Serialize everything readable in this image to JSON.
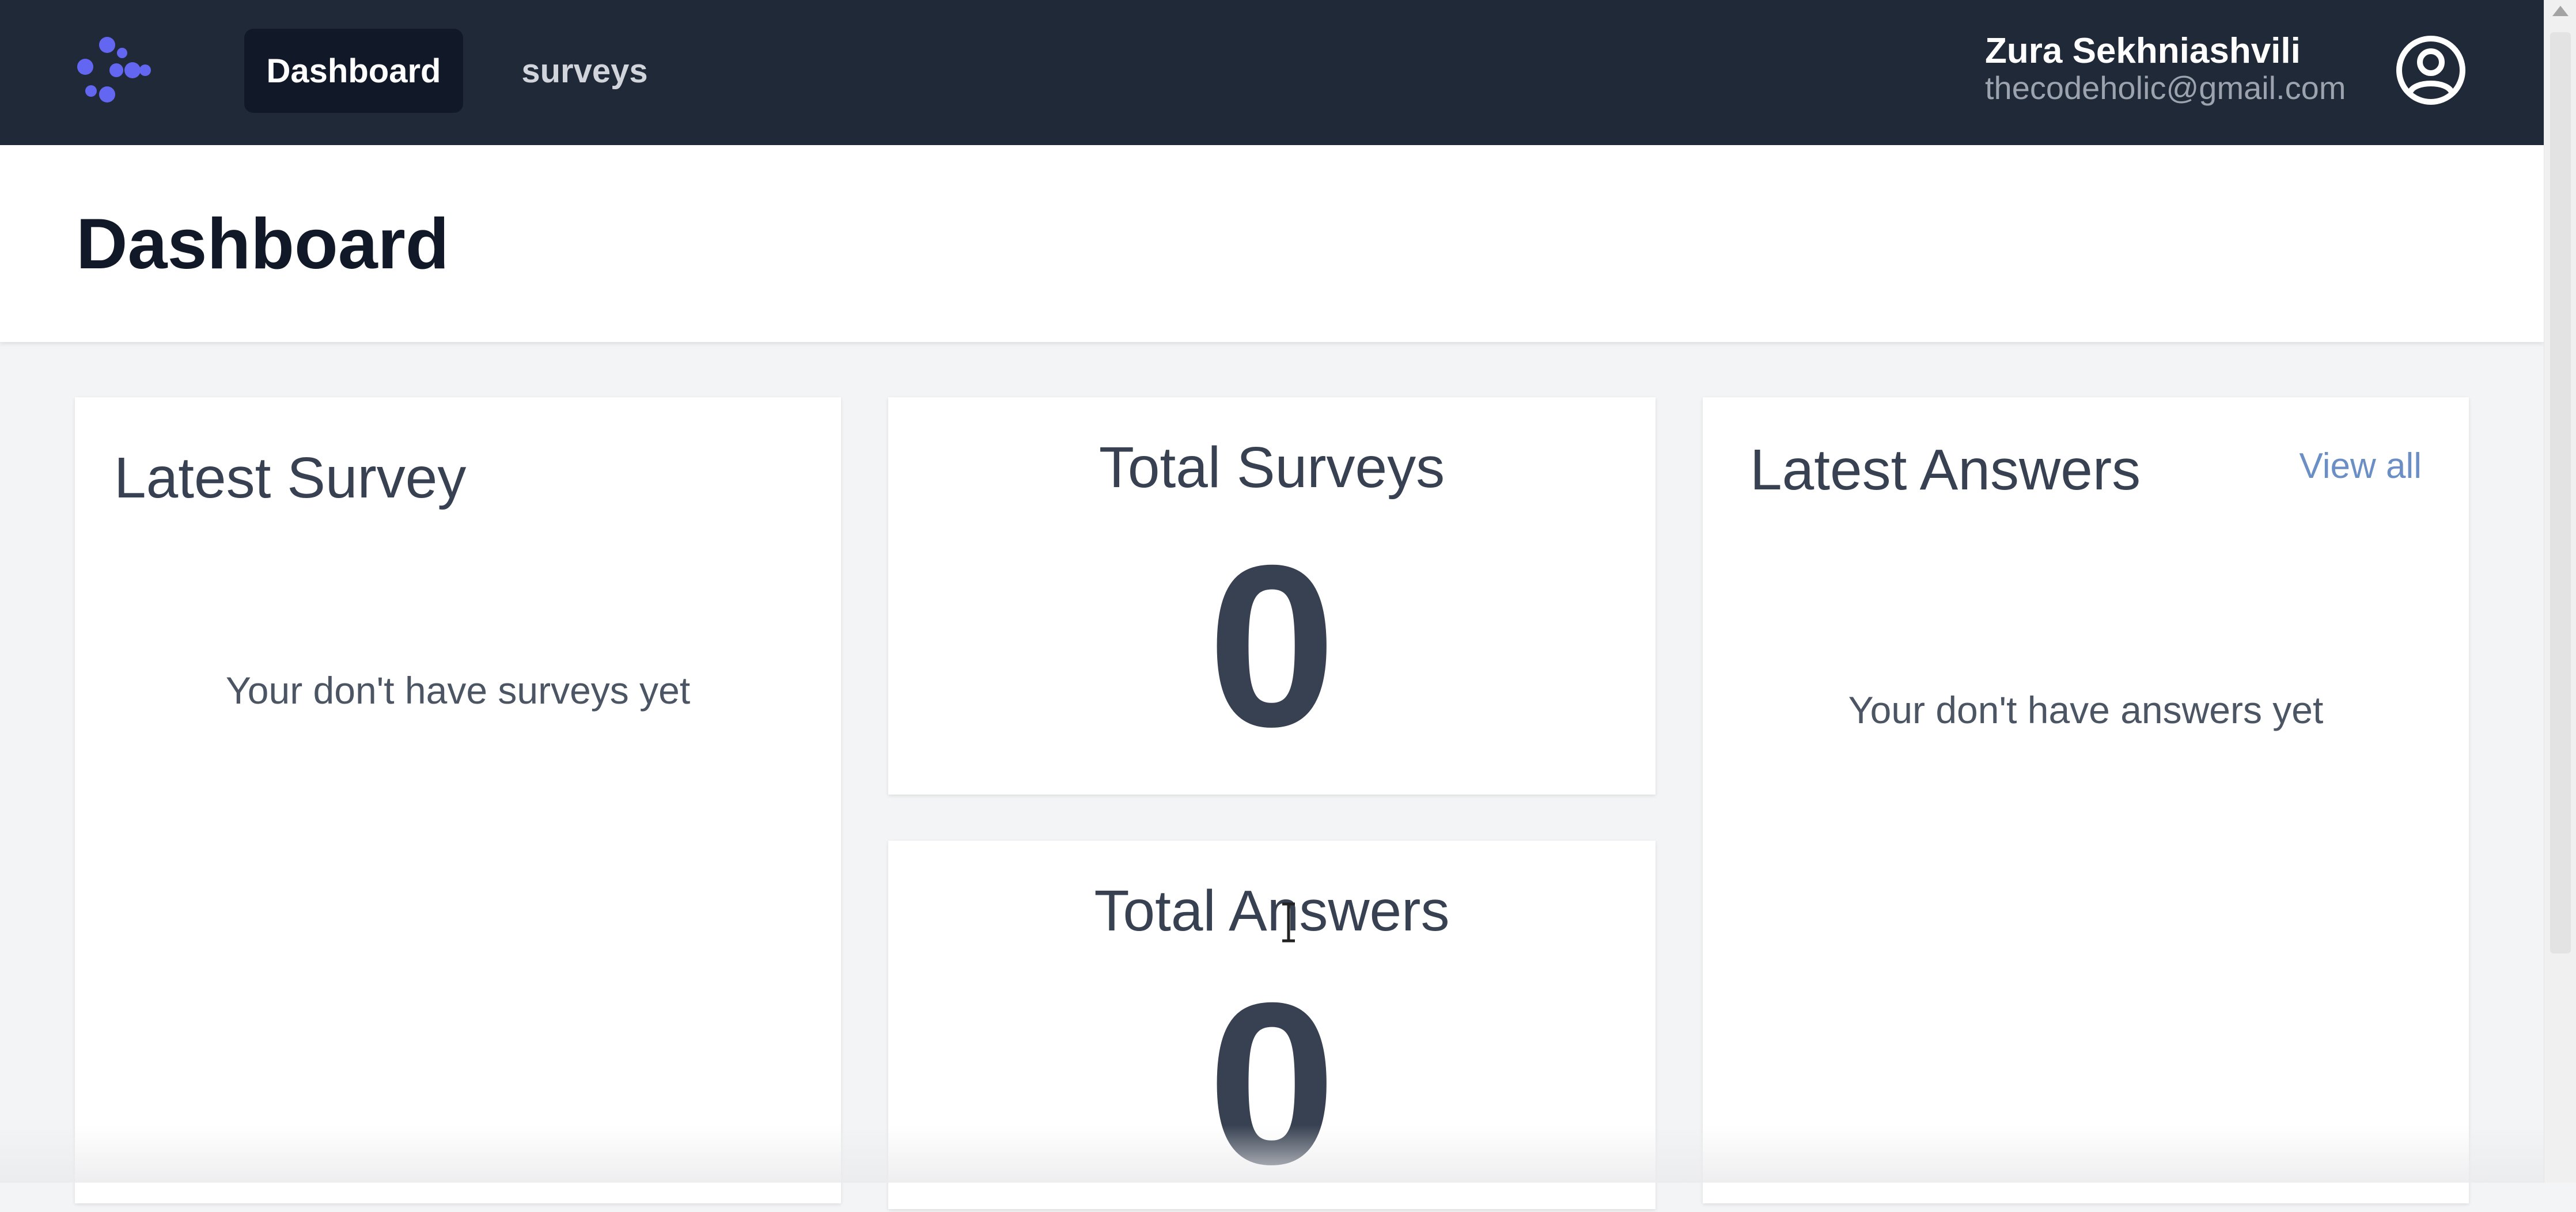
{
  "nav": {
    "items": [
      {
        "label": "Dashboard",
        "active": true
      },
      {
        "label": "surveys",
        "active": false
      }
    ],
    "user": {
      "name": "Zura Sekhniashvili",
      "email": "thecodeholic@gmail.com"
    },
    "logo_color": "#6366f1",
    "avatar_icon": "user-circle-icon"
  },
  "header": {
    "title": "Dashboard"
  },
  "cards": {
    "latest_survey": {
      "title": "Latest Survey",
      "empty_text": "Your don't have surveys yet"
    },
    "total_surveys": {
      "title": "Total Surveys",
      "value": "0"
    },
    "total_answers": {
      "title": "Total Answers",
      "value": "0"
    },
    "latest_answers": {
      "title": "Latest Answers",
      "view_all_label": "View all",
      "empty_text": "Your don't have answers yet"
    }
  },
  "colors": {
    "navbar_bg": "#1f2937",
    "active_nav_bg": "#111827",
    "link": "#6b8fc4",
    "page_bg": "#f3f4f6"
  }
}
